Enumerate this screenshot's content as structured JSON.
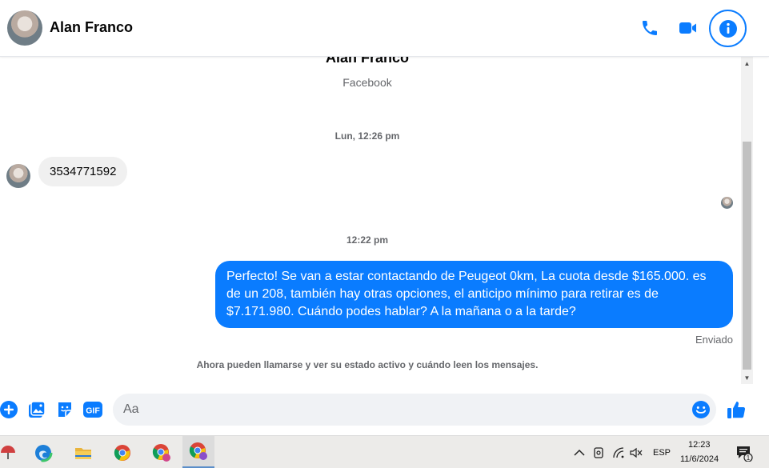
{
  "header": {
    "contact_name": "Alan Franco"
  },
  "thread": {
    "profile_name": "Alan Franco",
    "profile_source": "Facebook",
    "timestamp_1": "Lun, 12:26 pm",
    "incoming_message": "3534771592",
    "timestamp_2": "12:22 pm",
    "outgoing_message": "Perfecto!  Se van a estar contactando de Peugeot 0km, La cuota desde $165.000. es de un 208, también hay otras opciones, el anticipo mínimo para retirar es de $7.171.980. Cuándo podes hablar? A la mañana o a la tarde?",
    "sent_status": "Enviado",
    "system_note": "Ahora pueden llamarse y ver su estado activo y cuándo leen los mensajes."
  },
  "composer": {
    "placeholder": "Aa",
    "gif_label": "GIF"
  },
  "taskbar": {
    "language": "ESP",
    "time": "12:23",
    "date": "11/6/2024",
    "notification_count": "1"
  },
  "colors": {
    "accent": "#0a7cff",
    "incoming_bubble": "#f0f0f0",
    "secondary_text": "#65676b"
  }
}
